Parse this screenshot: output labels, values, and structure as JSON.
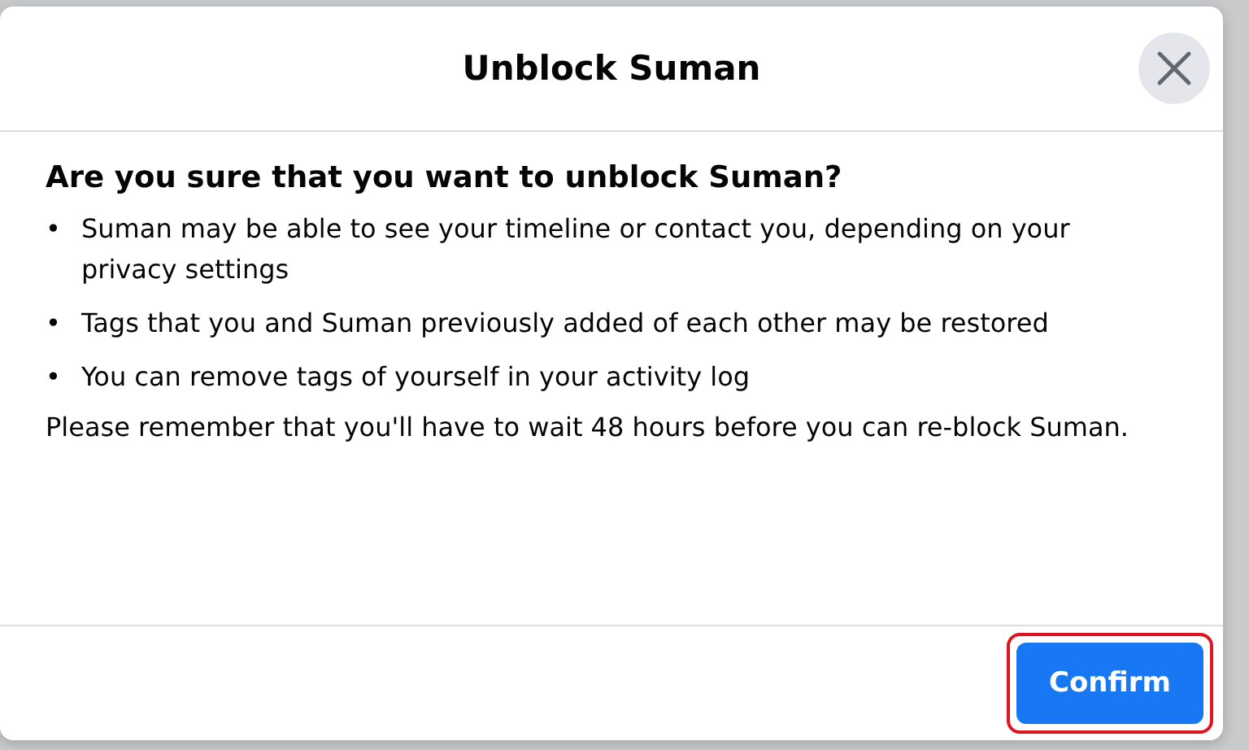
{
  "dialog": {
    "title": "Unblock Suman",
    "question": "Are you sure that you want to unblock Suman?",
    "points": [
      {
        "bullet": "•",
        "text": "Suman may be able to see your timeline or contact you, depending on your privacy settings"
      },
      {
        "bullet": "•",
        "text": "Tags that you and Suman previously added of each other may be restored"
      },
      {
        "bullet": "•",
        "text": "You can remove tags of yourself in your activity log"
      }
    ],
    "note": "Please remember that you'll have to wait 48 hours before you can re-block Suman.",
    "confirm": {
      "label": "Confirm",
      "highlighted": true
    }
  }
}
